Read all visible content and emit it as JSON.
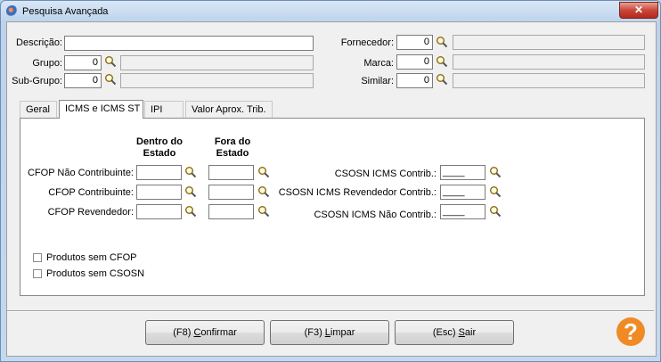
{
  "window": {
    "title": "Pesquisa Avançada",
    "close_glyph": "✕"
  },
  "filters": {
    "descricao_label": "Descrição:",
    "descricao_value": "",
    "grupo_label": "Grupo:",
    "grupo_value": "0",
    "subgrupo_label": "Sub-Grupo:",
    "subgrupo_value": "0",
    "fornecedor_label": "Fornecedor:",
    "fornecedor_value": "0",
    "marca_label": "Marca:",
    "marca_value": "0",
    "similar_label": "Similar:",
    "similar_value": "0"
  },
  "tabs": [
    {
      "label": "Geral",
      "active": false
    },
    {
      "label": "ICMS e ICMS ST",
      "active": true
    },
    {
      "label": "IPI",
      "active": false
    },
    {
      "label": "Valor Aprox. Trib.",
      "active": false
    }
  ],
  "icms": {
    "col_dentro": "Dentro do Estado",
    "col_fora": "Fora do Estado",
    "cfop_nao_contribuinte": "CFOP Não Contribuinte:",
    "cfop_contribuinte": "CFOP Contribuinte:",
    "cfop_revendedor": "CFOP Revendedor:",
    "csosn_contrib": "CSOSN ICMS Contrib.:",
    "csosn_revendedor": "CSOSN ICMS Revendedor Contrib.:",
    "csosn_nao_contrib": "CSOSN ICMS Não Contrib.:",
    "csosn_contrib_value": "____",
    "csosn_revendedor_value": "____",
    "csosn_nao_contrib_value": "____",
    "chk_sem_cfop": "Produtos sem CFOP",
    "chk_sem_csosn": "Produtos sem CSOSN"
  },
  "buttons": {
    "confirmar_prefix": "(F8) ",
    "confirmar_key": "C",
    "confirmar_rest": "onfirmar",
    "limpar_prefix": "(F3) ",
    "limpar_key": "L",
    "limpar_rest": "impar",
    "sair_prefix": "(Esc) ",
    "sair_key": "S",
    "sair_rest": "air",
    "help_glyph": "?"
  },
  "icons": {
    "search": "search-icon",
    "help": "help-icon",
    "app": "app-icon",
    "close": "close-icon"
  },
  "colors": {
    "title_gradient_top": "#d9e7f7",
    "close_red": "#c8473a",
    "help_orange": "#f08a24"
  }
}
